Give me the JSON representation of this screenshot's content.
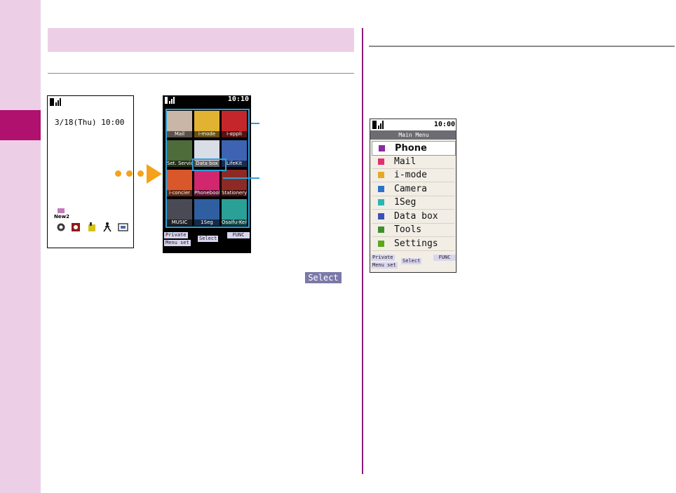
{
  "colors": {
    "sidebar": "#eccfe6",
    "sidebar_tab": "#b0106e",
    "divider": "#8e1b79",
    "arrow": "#f5a21a",
    "callout": "#2e9fd8",
    "softkey": "#d9d5ee"
  },
  "standby_screen": {
    "date_time": "3/18(Thu) 10:00",
    "mail_badge": "New2",
    "icons": [
      "clock-icon",
      "app-icon",
      "bag-icon",
      "walker-icon",
      "tv-icon"
    ]
  },
  "menu_screen": {
    "time": "10:10",
    "tiles": [
      {
        "label": "Mail",
        "color": "#c9b6a6"
      },
      {
        "label": "i-mode",
        "color": "#e2b232"
      },
      {
        "label": "i-αppli",
        "color": "#c5262b"
      },
      {
        "label": "Set. Service",
        "color": "#4e6b3a"
      },
      {
        "label": "Data box",
        "color": "#d8dde6"
      },
      {
        "label": "LifeKit",
        "color": "#3d63b2"
      },
      {
        "label": "i-concier",
        "color": "#d9572a"
      },
      {
        "label": "Phonebook",
        "color": "#d2276f"
      },
      {
        "label": "Stationery",
        "color": "#8e2a25"
      },
      {
        "label": "MUSIC",
        "color": "#4a4a55"
      },
      {
        "label": "1Seg",
        "color": "#2f5fa0"
      },
      {
        "label": "Osaifu-Keitai",
        "color": "#2aa096"
      }
    ],
    "softkeys": {
      "left_top": "Private",
      "left_bottom": "Menu set",
      "center": "Select",
      "right": "FUNC"
    }
  },
  "select_badge": "Select",
  "main_menu_screen": {
    "time": "10:00",
    "title": "Main Menu",
    "items": [
      {
        "label": "Phone",
        "icon": "phone-icon",
        "color": "#8b2aa2",
        "selected": true
      },
      {
        "label": "Mail",
        "icon": "mail-icon",
        "color": "#e0306e",
        "selected": false
      },
      {
        "label": "i-mode",
        "icon": "imode-icon",
        "color": "#e8a825",
        "selected": false
      },
      {
        "label": "Camera",
        "icon": "camera-icon",
        "color": "#2a73c8",
        "selected": false
      },
      {
        "label": "1Seg",
        "icon": "tv-icon",
        "color": "#2ab5b5",
        "selected": false
      },
      {
        "label": "Data box",
        "icon": "databox-icon",
        "color": "#3a52b5",
        "selected": false
      },
      {
        "label": "Tools",
        "icon": "tools-icon",
        "color": "#3f8f2a",
        "selected": false
      },
      {
        "label": "Settings",
        "icon": "wrench-icon",
        "color": "#5aa81c",
        "selected": false
      }
    ],
    "softkeys": {
      "left_top": "Private",
      "left_bottom": "Menu set",
      "center": "Select",
      "right": "FUNC"
    }
  }
}
